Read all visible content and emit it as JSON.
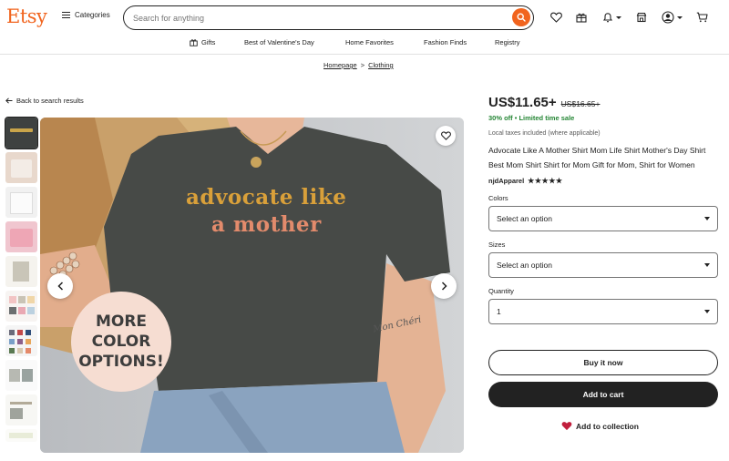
{
  "header": {
    "logo": "Etsy",
    "categories_label": "Categories",
    "search_placeholder": "Search for anything",
    "icons": [
      "heart-icon",
      "gift-icon",
      "bell-icon",
      "shop-icon",
      "avatar-icon",
      "cart-icon"
    ]
  },
  "subnav": {
    "items": [
      "Gifts",
      "Best of Valentine's Day",
      "Home Favorites",
      "Fashion Finds",
      "Registry"
    ]
  },
  "breadcrumb": {
    "items": [
      "Homepage",
      "Clothing"
    ],
    "separator": ">"
  },
  "back_link": "Back to search results",
  "gallery": {
    "bubble_lines": [
      "MORE",
      "COLOR",
      "OPTIONS!"
    ],
    "shirt_lines": [
      "advocate like",
      "a mother"
    ],
    "tattoo_text": "Mon Chéri"
  },
  "product": {
    "price": "US$11.65+",
    "original_price": "US$16.65+",
    "discount": "30% off • Limited time sale",
    "tax_note": "Local taxes included (where applicable)",
    "title": "Advocate Like A Mother Shirt Mom Life Shirt Mother's Day Shirt Best Mom Shirt Shirt for Mom Gift for Mom, Shirt for Women",
    "shop_name": "njdApparel",
    "stars": "★★★★★",
    "rating_stars": 5
  },
  "options": {
    "colors_label": "Colors",
    "colors_value": "Select an option",
    "sizes_label": "Sizes",
    "sizes_value": "Select an option",
    "quantity_label": "Quantity",
    "quantity_value": "1"
  },
  "actions": {
    "buy_now": "Buy it now",
    "add_to_cart": "Add to cart",
    "add_to_collection": "Add to collection"
  },
  "colors": {
    "brand": "#f1641e",
    "sale_green": "#258635",
    "favorite_red": "#c11f3d"
  }
}
